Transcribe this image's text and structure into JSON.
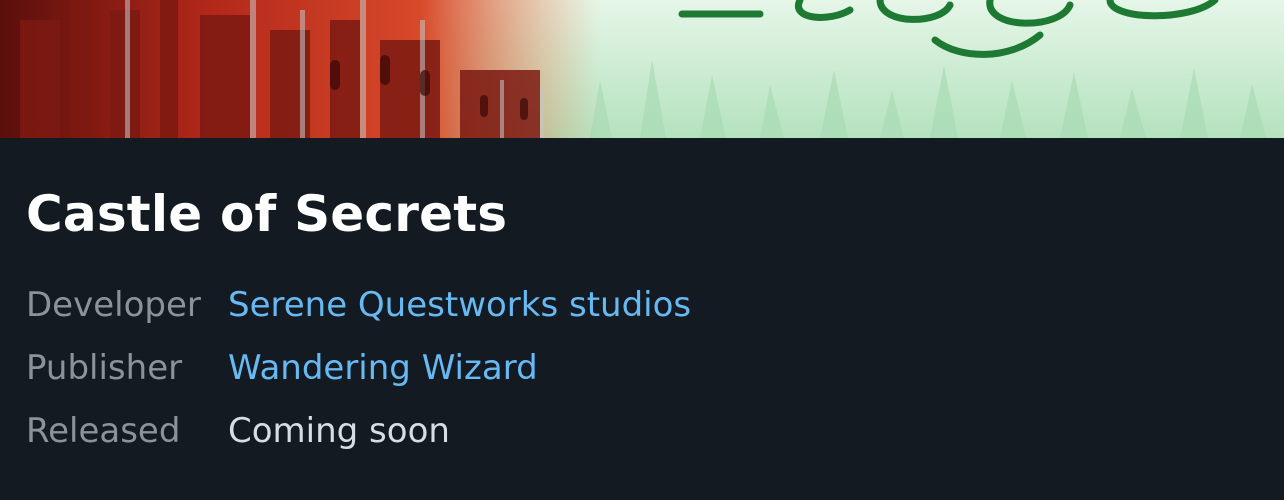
{
  "game": {
    "title": "Castle of Secrets",
    "cover_art": {
      "type": "illustration",
      "accent_colors": [
        "#c9331f",
        "#9fe0b0",
        "#1f7a32"
      ]
    }
  },
  "details": {
    "developer": {
      "label": "Developer",
      "value": "Serene Questworks studios"
    },
    "publisher": {
      "label": "Publisher",
      "value": "Wandering Wizard"
    },
    "released": {
      "label": "Released",
      "value": "Coming soon"
    }
  },
  "colors": {
    "background": "#131a22",
    "title": "#ffffff",
    "label": "#8a939c",
    "link": "#66b9f2",
    "value": "#d7dde2"
  }
}
